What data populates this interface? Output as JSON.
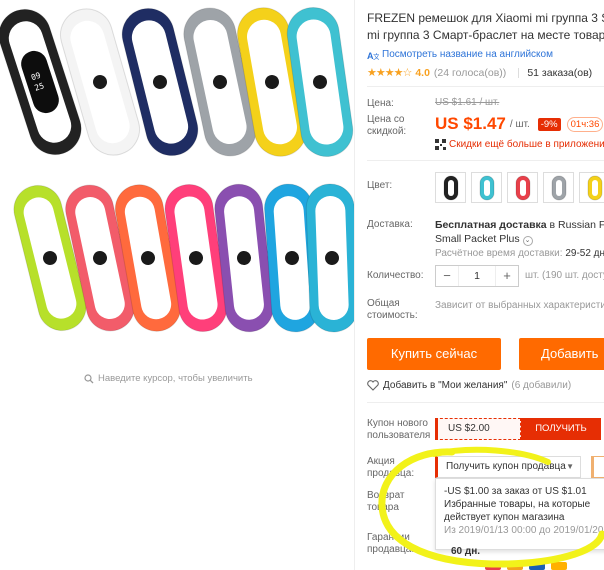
{
  "gallery": {
    "zoom_hint": "Наведите курсор, чтобы увеличить",
    "band_colors_top": [
      "#222222",
      "#f4f4f4",
      "#1f2d63",
      "#9ea3a8",
      "#f4d11a",
      "#3fc1d1"
    ],
    "band_colors_bottom": [
      "#b7e02a",
      "#f25c6a",
      "#ff6a3d",
      "#ff3f7a",
      "#8a4fb0",
      "#1fa5e0",
      "#2ab3d6"
    ]
  },
  "product": {
    "title_line1": "FREZEN ремешок для Xiaomi mi группа 3 S",
    "title_line2": "mi группа 3 Смарт-браслет на месте товар",
    "translate_link": "Посмотреть название на английском",
    "stars": "★★★★☆",
    "rating": "4.0",
    "votes": "(24 голоса(ов))",
    "orders": "51 заказа(ов)"
  },
  "price": {
    "label_price": "Цена:",
    "old_price": "US $1.61 / шт.",
    "label_discount_line1": "Цена со",
    "label_discount_line2": "скидкой:",
    "current_price": "US $1.47",
    "unit": "/ шт.",
    "discount": "-9%",
    "timer": "01ч:36",
    "app_promo": "Скидки ещё больше в приложени"
  },
  "color": {
    "label": "Цвет:",
    "swatches": [
      "#222222",
      "#3fc1d1",
      "#e8404a",
      "#9ea3a8",
      "#f4d11a"
    ]
  },
  "shipping": {
    "label": "Доставка:",
    "line1_bold": "Бесплатная доставка",
    "line1_rest": " в Russian Fed",
    "line2": "Small Packet Plus",
    "time_label": "Расчётное время доставки:",
    "time_value": "29-52 дн"
  },
  "quantity": {
    "label": "Количество:",
    "value": "1",
    "minus": "−",
    "plus": "+",
    "note": "шт. (190 шт. доступ"
  },
  "total": {
    "label_line1": "Общая",
    "label_line2": "стоимость:",
    "note": "Зависит от выбранных характеристи"
  },
  "actions": {
    "buy_now": "Купить сейчас",
    "add_to_cart": "Добавить",
    "wishlist": "Добавить в \"Мои желания\"",
    "wishlist_count": "(6 добавили)"
  },
  "coupons": {
    "new_user_label_line1": "Купон нового",
    "new_user_label_line2": "пользователя",
    "new_user_value": "US $2.00",
    "get_button": "ПОЛУЧИТЬ",
    "seller_label_line1": "Акция",
    "seller_label_line2": "продавца:",
    "seller_button": "Получить купон продавца",
    "dropdown_line1": "-US $1.00 за заказ от US $1.01",
    "dropdown_line2": "Избранные товары, на которые",
    "dropdown_line3": "действует купон магазина",
    "dropdown_line4": "Из 2019/01/13 00:00 до 2019/01/20"
  },
  "returns": {
    "label_line1": "Возврат",
    "label_line2": "товара"
  },
  "guarantee": {
    "label_line1": "Гарантии",
    "label_line2": "продавца:",
    "value": "60 дн."
  },
  "accent": "#ff6a00",
  "highlight_color": "#f2f21a"
}
